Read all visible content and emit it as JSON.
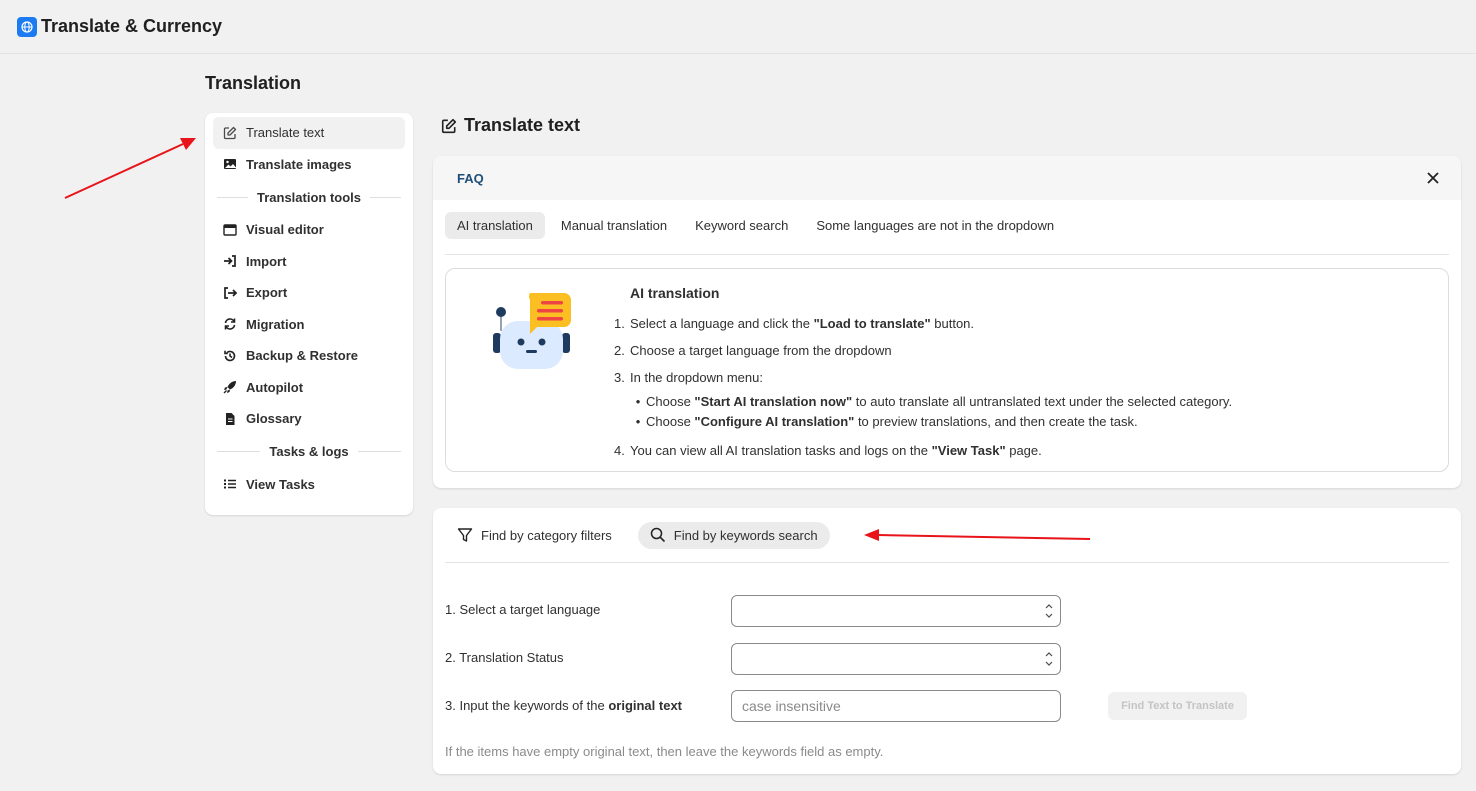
{
  "app": {
    "title": "Translate & Currency"
  },
  "section": {
    "title": "Translation"
  },
  "sidebar": {
    "items": [
      {
        "label": "Translate text",
        "icon": "edit-icon"
      },
      {
        "label": "Translate images",
        "icon": "image-icon"
      }
    ],
    "group_tools": "Translation tools",
    "tools": [
      {
        "label": "Visual editor",
        "icon": "browser-window-icon"
      },
      {
        "label": "Import",
        "icon": "import-icon"
      },
      {
        "label": "Export",
        "icon": "export-icon"
      },
      {
        "label": "Migration",
        "icon": "refresh-icon"
      },
      {
        "label": "Backup & Restore",
        "icon": "history-icon"
      },
      {
        "label": "Autopilot",
        "icon": "rocket-icon"
      },
      {
        "label": "Glossary",
        "icon": "document-icon"
      }
    ],
    "group_tasks": "Tasks & logs",
    "tasks": [
      {
        "label": "View Tasks",
        "icon": "list-icon"
      }
    ]
  },
  "page": {
    "title": "Translate text"
  },
  "faq": {
    "title": "FAQ",
    "tabs": [
      "AI translation",
      "Manual translation",
      "Keyword search",
      "Some languages are not in the dropdown"
    ],
    "active_tab": "AI translation",
    "content": {
      "title": "AI translation",
      "step1_pre": "Select a language and click the ",
      "step1_bold": "\"Load to translate\"",
      "step1_post": " button.",
      "step2": "Choose a target language from the dropdown",
      "step3": "In the dropdown menu:",
      "bullet1_pre": "Choose ",
      "bullet1_bold": "\"Start AI translation now\"",
      "bullet1_post": " to auto translate all untranslated text under the selected category.",
      "bullet2_pre": "Choose ",
      "bullet2_bold": "\"Configure AI translation\"",
      "bullet2_post": " to preview translations, and then create the task.",
      "step4_pre": "You can view all AI translation tasks and logs on the ",
      "step4_bold": "\"View Task\"",
      "step4_post": " page."
    }
  },
  "search": {
    "modes": [
      {
        "label": "Find by category filters",
        "icon": "filter-icon"
      },
      {
        "label": "Find by keywords search",
        "icon": "search-icon"
      }
    ],
    "active_mode": "Find by keywords search",
    "label_language": "1. Select a target language",
    "label_status": "2. Translation Status",
    "label_keywords_pre": "3. Input the keywords of the ",
    "label_keywords_bold": "original text",
    "keywords_placeholder": "case insensitive",
    "keywords_value": "",
    "find_button": "Find Text to Translate",
    "hint": "If the items have empty original text, then leave the keywords field as empty."
  },
  "colors": {
    "accent": "#1d7bf2",
    "annotation_arrow": "#e8141a",
    "faq_title": "#1f4e79"
  }
}
